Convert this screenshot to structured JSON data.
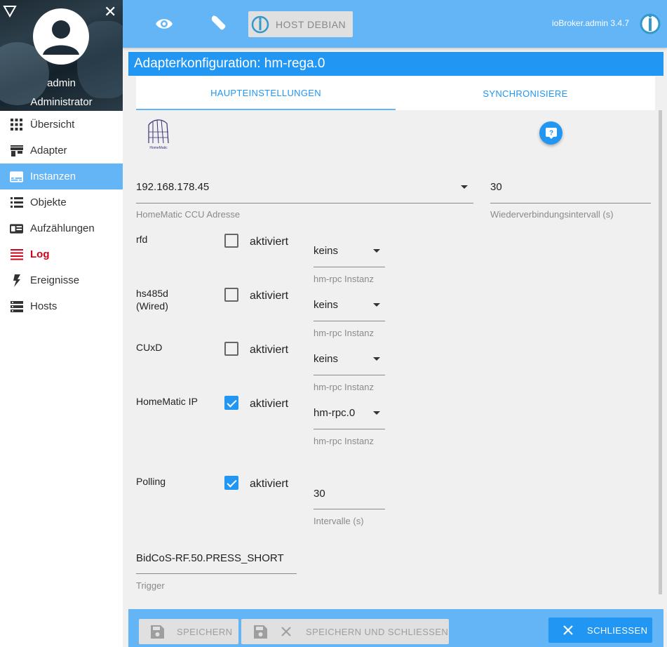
{
  "sidebar": {
    "user": {
      "name": "admin",
      "role": "Administrator"
    },
    "items": [
      {
        "label": "Übersicht",
        "icon": "grid-icon"
      },
      {
        "label": "Adapter",
        "icon": "store-icon"
      },
      {
        "label": "Instanzen",
        "icon": "subtitles-icon"
      },
      {
        "label": "Objekte",
        "icon": "list-icon"
      },
      {
        "label": "Aufzählungen",
        "icon": "card-list-icon"
      },
      {
        "label": "Log",
        "icon": "lines-icon"
      },
      {
        "label": "Ereignisse",
        "icon": "lightning-icon"
      },
      {
        "label": "Hosts",
        "icon": "server-icon"
      }
    ]
  },
  "topbar": {
    "host_label": "HOST DEBIAN",
    "version": "ioBroker.admin 3.4.7"
  },
  "dialog": {
    "title": "Adapterkonfiguration: hm-rega.0",
    "tabs": [
      "HAUPTEINSTELLUNGEN",
      "SYNCHRONISIERE"
    ],
    "logo_text": "HomeMatic",
    "ccu_address": {
      "value": "192.168.178.45",
      "helper": "HomeMatic CCU Adresse"
    },
    "reconnect": {
      "value": "30",
      "helper": "Wiederverbindungsintervall (s)"
    },
    "interfaces": [
      {
        "label": "rfd",
        "checked": false,
        "checkbox_label": "aktiviert",
        "select": "keins",
        "helper": "hm-rpc Instanz"
      },
      {
        "label": "hs485d\n(Wired)",
        "checked": false,
        "checkbox_label": "aktiviert",
        "select": "keins",
        "helper": "hm-rpc Instanz"
      },
      {
        "label": "CUxD",
        "checked": false,
        "checkbox_label": "aktiviert",
        "select": "keins",
        "helper": "hm-rpc Instanz"
      },
      {
        "label": "HomeMatic IP",
        "checked": true,
        "checkbox_label": "aktiviert",
        "select": "hm-rpc.0",
        "helper": "hm-rpc Instanz"
      }
    ],
    "polling": {
      "label": "Polling",
      "checked": true,
      "checkbox_label": "aktiviert",
      "value": "30",
      "helper": "Intervalle (s)"
    },
    "trigger": {
      "value": "BidCoS-RF.50.PRESS_SHORT",
      "helper": "Trigger"
    }
  },
  "footer": {
    "save": "SPEICHERN",
    "save_close": "SPEICHERN UND SCHLIESSEN",
    "close": "SCHLIESSEN"
  },
  "colors": {
    "primary": "#2196f3",
    "bar": "#64b5f6",
    "log": "#d0021b"
  }
}
